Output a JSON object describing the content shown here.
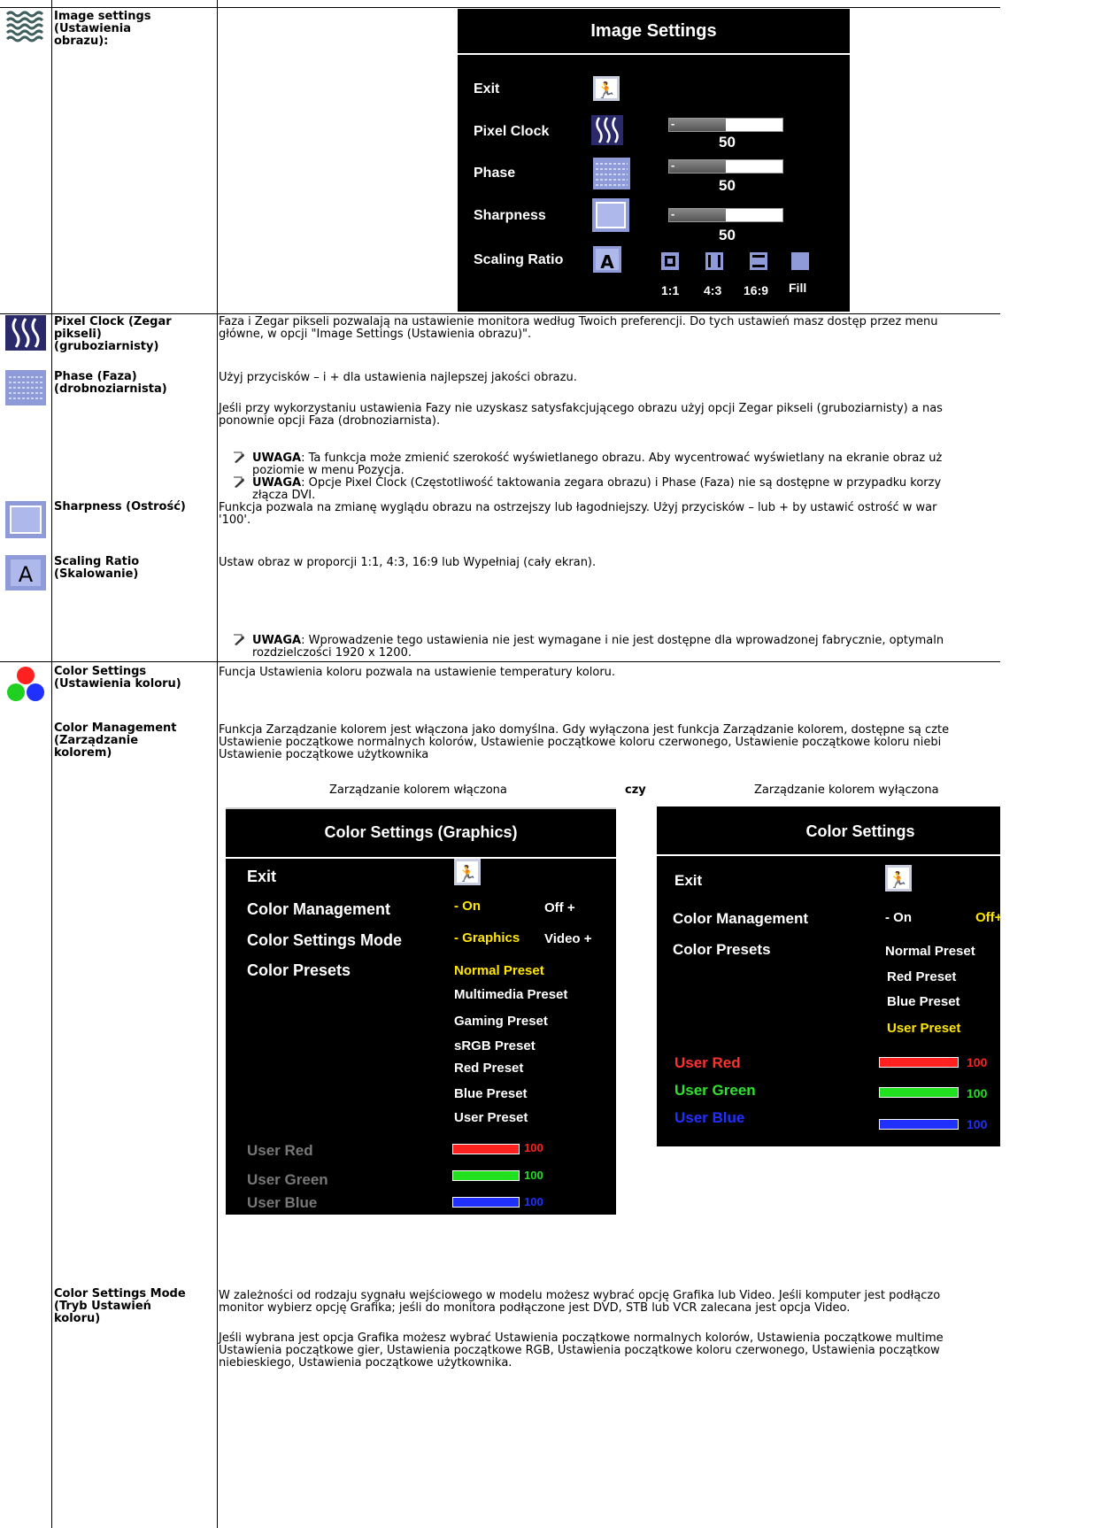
{
  "rows": {
    "image_settings": {
      "label": "Image settings (Ustawienia obrazu):",
      "osd": {
        "title": "Image Settings",
        "items": [
          "Exit",
          "Pixel Clock",
          "Phase",
          "Sharpness",
          "Scaling Ratio"
        ],
        "slider_values": [
          "50",
          "50",
          "50"
        ],
        "slider_fraction": 0.5,
        "ratio_labels": [
          "1:1",
          "4:3",
          "16:9",
          "Fill"
        ]
      }
    },
    "pixel_clock": {
      "label": "Pixel Clock (Zegar pikseli) (gruboziarnisty)",
      "text_1": "Faza i Zegar pikseli pozwalają na ustawienie monitora według Twoich preferencji. Do tych ustawień masz dostęp przez menu",
      "text_2": "główne, w opcji \"Image Settings (Ustawienia obrazu)\"."
    },
    "phase": {
      "label": "Phase (Faza) (drobnoziarnista)",
      "text_1": "Użyj przycisków – i + dla ustawienia najlepszej jakości obrazu.",
      "text_2a": "Jeśli przy wykorzystaniu ustawienia Fazy nie uzyskasz satysfakcjującego obrazu użyj opcji Zegar pikseli (gruboziarnisty) a nas",
      "text_2b": "ponownie opcji Faza (drobnoziarnista).",
      "note1_bold": "UWAGA",
      "note1_a": ": Ta funkcja może zmienić szerokość wyświetlanego obrazu.   Aby wycentrować wyświetlany na ekranie obraz uż",
      "note1_b": "poziomie w menu Pozycja.",
      "note2_bold": "UWAGA",
      "note2_a": ": Opcje Pixel Clock (Częstotliwość taktowania zegara obrazu) i Phase (Faza) nie są dostępne w przypadku korzy",
      "note2_b": "złącza DVI."
    },
    "sharpness": {
      "label": "Sharpness (Ostrość)",
      "text_1": "Funkcja pozwala na zmianę wyglądu obrazu na ostrzejszy lub łagodniejszy. Użyj przycisków – lub + by ustawić ostrość w war",
      "text_2": "'100'."
    },
    "scaling": {
      "label": "Scaling Ratio (Skalowanie)",
      "text_1": "Ustaw obraz w proporcji 1:1, 4:3, 16:9 lub Wypełniaj (cały ekran).",
      "note_bold": "UWAGA",
      "note_a": ": Wprowadzenie tego ustawienia nie jest wymagane i nie jest dostępne dla wprowadzonej fabrycznie, optymaln",
      "note_b": "rozdzielczości 1920 x 1200."
    },
    "color_settings": {
      "label": "Color Settings (Ustawienia koloru)",
      "text_1": "Funcja Ustawienia koloru pozwala na ustawienie temperatury koloru."
    },
    "color_management": {
      "label": "Color Management (Zarządzanie kolorem)",
      "text_1": "Funkcja Zarządzanie kolorem jest włączona jako domyślna. Gdy wyłączona jest funkcja Zarządzanie kolorem, dostępne są czte",
      "text_2": "Ustawienie początkowe normalnych kolorów, Ustawienie początkowe koloru czerwonego, Ustawienie początkowe koloru niebi",
      "text_3": "Ustawienie początkowe użytkownika",
      "caption_on": "Zarządzanie kolorem włączona",
      "caption_or": "czy",
      "caption_off": "Zarządzanie kolorem wyłączona"
    },
    "color_mode": {
      "label": "Color Settings Mode (Tryb Ustawień koloru)",
      "text_1": "W zależności od rodzaju sygnału wejściowego w modelu możesz wybrać opcję Grafika lub Video.  Jeśli komputer jest podłączo",
      "text_2": "monitor wybierz opcję Grafika; jeśli do monitora podłączone jest DVD, STB lub VCR zalecana jest opcja Video.",
      "text_3": "Jeśli wybrana jest opcja Grafika możesz wybrać Ustawienia początkowe normalnych kolorów, Ustawienia początkowe multime",
      "text_4": "Ustawienia początkowe gier, Ustawienia początkowe RGB, Ustawienia początkowe koloru czerwonego, Ustawienia początkow",
      "text_5": "niebieskiego, Ustawienia początkowe użytkownika."
    }
  },
  "osd_on": {
    "title": "Color Settings (Graphics)",
    "items": [
      "Exit",
      "Color Management",
      "Color Settings Mode",
      "Color Presets"
    ],
    "cm_on": "- On",
    "cm_off": "Off +",
    "mode_g": "- Graphics",
    "mode_v": "Video +",
    "presets": [
      "Normal Preset",
      "Multimedia Preset",
      "Gaming Preset",
      "sRGB Preset",
      "Red Preset",
      "Blue Preset",
      "User Preset"
    ],
    "user": [
      "User Red",
      "User Green",
      "User Blue"
    ],
    "user_values": [
      "100",
      "100",
      "100"
    ]
  },
  "osd_off": {
    "title": "Color Settings",
    "items": [
      "Exit",
      "Color Management",
      "Color Presets"
    ],
    "cm_on": "- On",
    "cm_off": "Off+",
    "presets": [
      "Normal Preset",
      "Red Preset",
      "Blue Preset",
      "User Preset"
    ],
    "user": [
      "User Red",
      "User Green",
      "User Blue"
    ],
    "user_values": [
      "100",
      "100",
      "100"
    ]
  },
  "colors": {
    "osd_yellow": "#ffe600",
    "red": "#ff2020",
    "green": "#20e020",
    "blue": "#2030ff"
  }
}
